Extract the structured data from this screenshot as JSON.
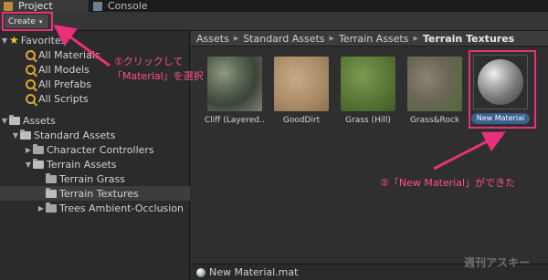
{
  "tabs": [
    {
      "label": "Project",
      "icon": "project-icon"
    },
    {
      "label": "Console",
      "icon": "console-icon"
    }
  ],
  "toolbar": {
    "create_label": "Create",
    "create_caret": "▾"
  },
  "favorites": {
    "label": "Favorites",
    "items": [
      "All Materials",
      "All Models",
      "All Prefabs",
      "All Scripts"
    ]
  },
  "tree": {
    "assets": "Assets",
    "standard_assets": "Standard Assets",
    "character_controllers": "Character Controllers",
    "terrain_assets": "Terrain Assets",
    "terrain_grass": "Terrain Grass",
    "terrain_textures": "Terrain Textures",
    "trees": "Trees Ambient-Occlusion"
  },
  "breadcrumb": [
    "Assets",
    "Standard Assets",
    "Terrain Assets",
    "Terrain Textures"
  ],
  "assets": [
    {
      "label": "Cliff (Layered…"
    },
    {
      "label": "GoodDirt"
    },
    {
      "label": "Grass (Hill)"
    },
    {
      "label": "Grass&Rock"
    }
  ],
  "new_material": {
    "label": "New Material"
  },
  "status": {
    "filename": "New Material.mat"
  },
  "annotations": {
    "step1_line1": "①クリックして",
    "step1_line2": "「Material」を選択",
    "step2": "②「New Material」ができた"
  },
  "watermark": "週刊アスキー",
  "colors": {
    "highlight": "#e8317a",
    "annotation_text": "#ff4f8f",
    "selection": "#3b5f8e"
  }
}
